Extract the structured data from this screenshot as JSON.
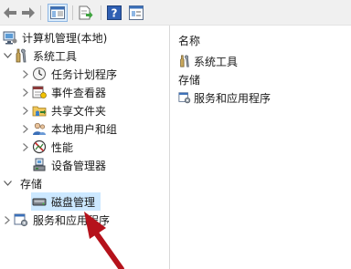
{
  "toolbar": {
    "back_icon": "back-arrow-icon",
    "forward_icon": "forward-arrow-icon",
    "show_hide_icon": "console-tree-icon",
    "export_icon": "export-list-icon",
    "help_icon": "help-icon",
    "properties_icon": "properties-icon",
    "help_glyph": "?"
  },
  "tree": {
    "root": "计算机管理(本地)",
    "system_tools": "系统工具",
    "task_scheduler": "任务计划程序",
    "event_viewer": "事件查看器",
    "shared_folders": "共享文件夹",
    "local_users": "本地用户和组",
    "performance": "性能",
    "device_manager": "设备管理器",
    "storage": "存储",
    "disk_management": "磁盘管理",
    "services_apps": "服务和应用程序"
  },
  "right": {
    "column_header": "名称",
    "items": [
      "系统工具",
      "存储",
      "服务和应用程序"
    ]
  },
  "colors": {
    "arrow": "#b5121b",
    "selection": "#cce8ff",
    "toolbar_bg": "#f0f0f0"
  }
}
